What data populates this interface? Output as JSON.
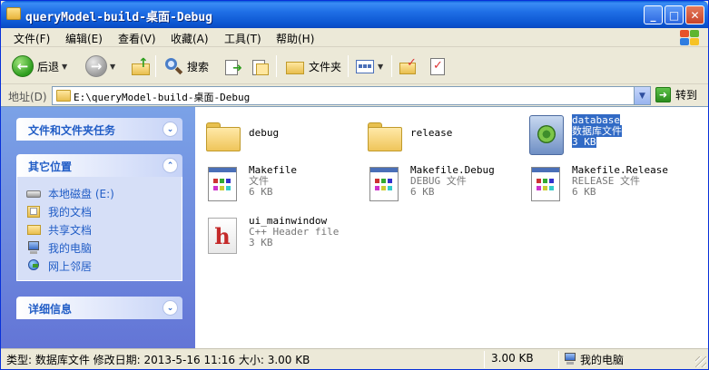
{
  "window": {
    "title": "queryModel-build-桌面-Debug",
    "minimize_glyph": "_",
    "maximize_glyph": "□",
    "close_glyph": "✕"
  },
  "menu": {
    "items": [
      "文件(F)",
      "编辑(E)",
      "查看(V)",
      "收藏(A)",
      "工具(T)",
      "帮助(H)"
    ]
  },
  "toolbar": {
    "back_label": "后退",
    "search_label": "搜索",
    "folders_label": "文件夹"
  },
  "address": {
    "label": "地址(D)",
    "value": "E:\\queryModel-build-桌面-Debug",
    "go_label": "转到"
  },
  "taskpane": {
    "file_tasks_title": "文件和文件夹任务",
    "other_places_title": "其它位置",
    "places": [
      {
        "label": "本地磁盘 (E:)",
        "icon": "disk-icon"
      },
      {
        "label": "我的文档",
        "icon": "documents-icon"
      },
      {
        "label": "共享文档",
        "icon": "shared-folder-icon"
      },
      {
        "label": "我的电脑",
        "icon": "computer-icon"
      },
      {
        "label": "网上邻居",
        "icon": "network-icon"
      }
    ],
    "details_title": "详细信息"
  },
  "files": [
    {
      "name": "debug",
      "type": "",
      "size": "",
      "icon": "folder-icon"
    },
    {
      "name": "release",
      "type": "",
      "size": "",
      "icon": "folder-icon"
    },
    {
      "name": "database",
      "type": "数据库文件",
      "size": "3 KB",
      "icon": "database-icon",
      "selected": true
    },
    {
      "name": "Makefile",
      "type": "文件",
      "size": "6 KB",
      "icon": "document-icon"
    },
    {
      "name": "Makefile.Debug",
      "type": "DEBUG 文件",
      "size": "6 KB",
      "icon": "document-icon"
    },
    {
      "name": "Makefile.Release",
      "type": "RELEASE 文件",
      "size": "6 KB",
      "icon": "document-icon"
    },
    {
      "name": "ui_mainwindow",
      "type": "C++ Header file",
      "size": "3 KB",
      "icon": "header-file-icon"
    }
  ],
  "status": {
    "info": "类型: 数据库文件 修改日期: 2013-5-16 11:16 大小: 3.00 KB",
    "size": "3.00 KB",
    "location": "我的电脑"
  }
}
